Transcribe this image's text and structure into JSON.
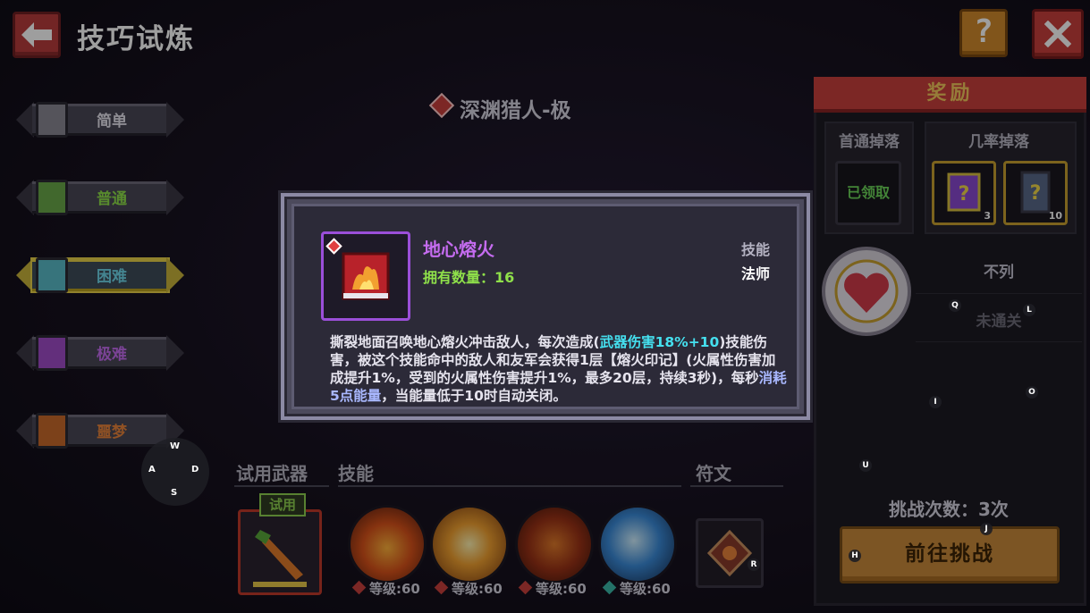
{
  "header": {
    "title": "技巧试炼"
  },
  "difficulties": [
    {
      "label": "简单",
      "color": "#e6e4ee",
      "icon": "skull-icon"
    },
    {
      "label": "普通",
      "color": "#8fe04a",
      "icon": "goblin-icon"
    },
    {
      "label": "困难",
      "color": "#6fd6e8",
      "icon": "ghost-icon"
    },
    {
      "label": "极难",
      "color": "#c56cf0",
      "icon": "demon-icon"
    },
    {
      "label": "噩梦",
      "color": "#e8843a",
      "icon": "dragon-icon"
    }
  ],
  "stage": {
    "name": "深渊猎人-极"
  },
  "loadout": {
    "weapon_title": "试用武器",
    "weapon_tag": "试用",
    "skills_title": "技能",
    "runes_title": "符文",
    "skills": [
      {
        "level": "等级:60",
        "gem": "fire"
      },
      {
        "level": "等级:60",
        "gem": "fire"
      },
      {
        "level": "等级:60",
        "gem": "fire"
      },
      {
        "level": "等级:60",
        "gem": "ice"
      }
    ]
  },
  "reward": {
    "title": "奖励",
    "first_drop_title": "首通掉落",
    "chance_drop_title": "几率掉落",
    "claimed_label": "已领取",
    "items": [
      {
        "count": "3"
      },
      {
        "count": "10"
      }
    ],
    "rank_label": "不列",
    "status_label": "未通关",
    "challenge_count": "挑战次数：3次",
    "go_button": "前往挑战"
  },
  "popup": {
    "skill_name": "地心熔火",
    "owned": "拥有数量：16",
    "type": "技能",
    "class": "法师",
    "desc_part1": "撕裂地面召唤地心熔火冲击敌人，每次造成(",
    "desc_hl1": "武器伤害18%+10",
    "desc_part2": ")技能伤害，被这个技能命中的敌人和友军会获得1层【熔火印记】(火属性伤害加成提升1%，受到的火属性伤害提升1%，最多20层，持续3秒)，每秒",
    "desc_hl2": "消耗5点能量",
    "desc_part3": "，当能量低于10时自动关闭。"
  },
  "controls": {
    "dpad": {
      "up": "W",
      "left": "A",
      "right": "D",
      "down": "S"
    },
    "hints": [
      "Q",
      "L",
      "I",
      "O",
      "U",
      "H",
      "J",
      "R"
    ]
  },
  "colors": {
    "accent_red": "#c8403c",
    "gold": "#c98a3a",
    "purple": "#c56cf0",
    "green": "#8fe04a",
    "cyan": "#45e0ef"
  }
}
